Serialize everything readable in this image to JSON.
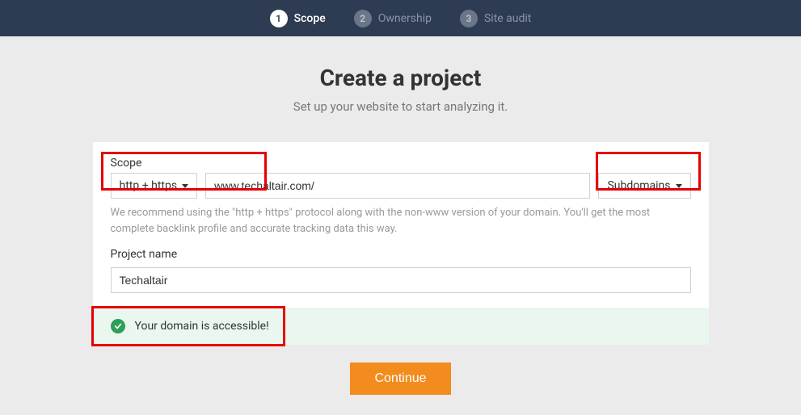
{
  "stepper": {
    "steps": [
      {
        "num": "1",
        "label": "Scope",
        "active": true
      },
      {
        "num": "2",
        "label": "Ownership",
        "active": false
      },
      {
        "num": "3",
        "label": "Site audit",
        "active": false
      }
    ]
  },
  "header": {
    "title": "Create a project",
    "subtitle": "Set up your website to start analyzing it."
  },
  "form": {
    "scope_label": "Scope",
    "protocol_value": "http + https",
    "url_value": "www.techaltair.com/",
    "subdomains_value": "Subdomains",
    "recommend_text": "We recommend using the \"http + https\" protocol along with the non-www version of your domain. You'll get the most complete backlink profile and accurate tracking data this way.",
    "project_name_label": "Project name",
    "project_name_value": "Techaltair"
  },
  "status": {
    "message": "Your domain is accessible!"
  },
  "actions": {
    "continue_label": "Continue"
  }
}
